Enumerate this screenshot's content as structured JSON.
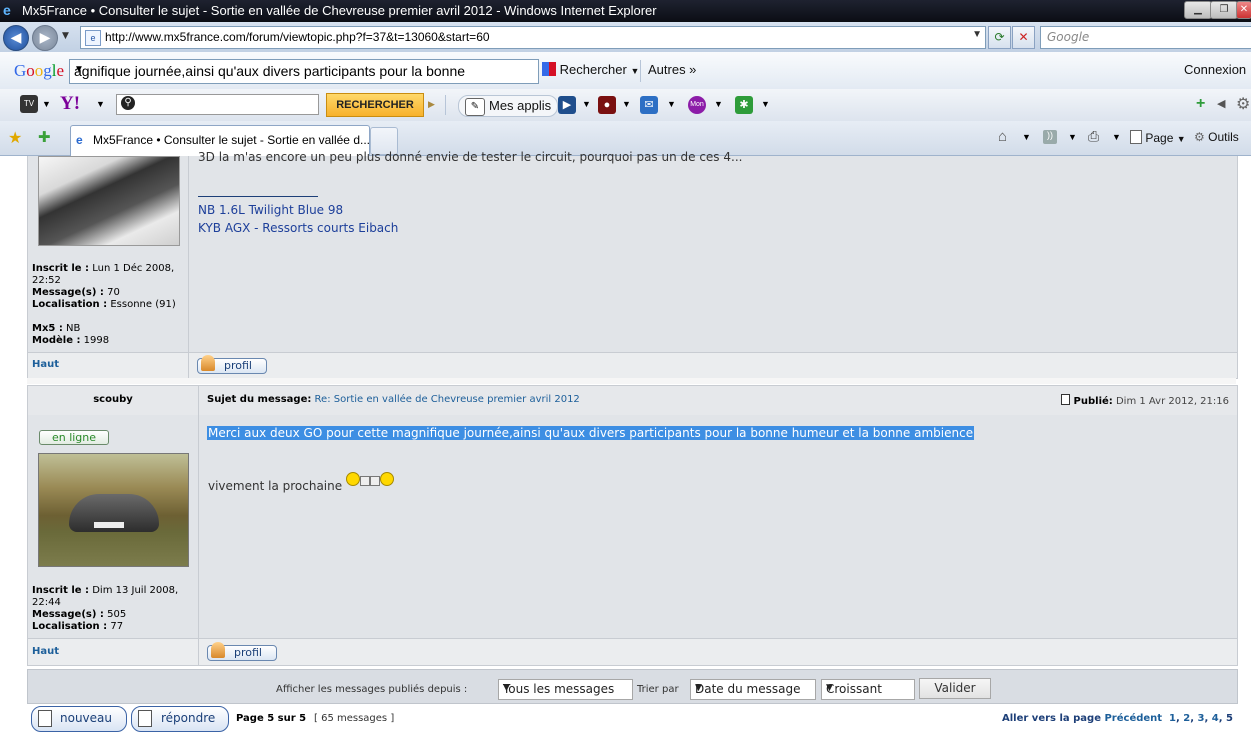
{
  "window": {
    "title": "Mx5France • Consulter le sujet - Sortie en vallée de Chevreuse premier avril 2012 - Windows Internet Explorer"
  },
  "addressbar": {
    "url": "http://www.mx5france.com/forum/viewtopic.php?f=37&t=13060&start=60",
    "search_placeholder": "Google"
  },
  "google_toolbar": {
    "logo": "Google",
    "query": "agnifique journée,ainsi qu'aux divers participants pour la bonne",
    "search_label": "Rechercher",
    "more_label": "Autres »",
    "login_label": "Connexion"
  },
  "yahoo_toolbar": {
    "search_button": "RECHERCHER",
    "apps_label": "Mes applis"
  },
  "tabs": {
    "active_tab": "Mx5France • Consulter le sujet - Sortie en vallée d...",
    "page_menu": "Page",
    "tools_menu": "Outils"
  },
  "post1": {
    "body_partial": "3D la m'as encore un peu plus donné envie de tester le circuit, pourquoi pas un de ces 4...",
    "signature_line1": "NB 1.6L Twilight Blue 98",
    "signature_line2": "KYB AGX - Ressorts courts Eibach",
    "registered_label": "Inscrit le :",
    "registered_value": "Lun 1 Déc 2008, 22:52",
    "messages_label": "Message(s) :",
    "messages_value": "70",
    "location_label": "Localisation :",
    "location_value": "Essonne (91)",
    "car_label": "Mx5 :",
    "car_value": "NB",
    "model_label": "Modèle :",
    "model_value": "1998",
    "top_link": "Haut",
    "profile_button": "profil"
  },
  "post2": {
    "author": "scouby",
    "subject_label": "Sujet du message:",
    "subject_value": "Re: Sortie en vallée de Chevreuse premier avril 2012",
    "published_label": "Publié:",
    "published_value": "Dim 1 Avr 2012, 21:16",
    "online_badge": "en ligne",
    "body_highlighted": "Merci aux deux GO pour cette magnifique journée,ainsi qu'aux divers participants pour la bonne humeur et la bonne ambience",
    "body_line2": "vivement la prochaine",
    "registered_label": "Inscrit le :",
    "registered_value": "Dim 13 Juil 2008, 22:44",
    "messages_label": "Message(s) :",
    "messages_value": "505",
    "location_label": "Localisation :",
    "location_value": "77",
    "top_link": "Haut",
    "profile_button": "profil"
  },
  "filter_bar": {
    "display_label": "Afficher les messages publiés depuis :",
    "display_value": "Tous les messages",
    "sort_label": "Trier par",
    "sort_value": "Date du message",
    "order_value": "Croissant",
    "submit": "Valider"
  },
  "footer": {
    "new_button": "nouveau",
    "reply_button": "répondre",
    "page_info": "Page 5 sur 5",
    "messages_count": "[ 65 messages ]",
    "goto_label": "Aller vers la page",
    "prev_label": "Précédent",
    "pages": [
      "1",
      "2",
      "3",
      "4",
      "5"
    ]
  }
}
